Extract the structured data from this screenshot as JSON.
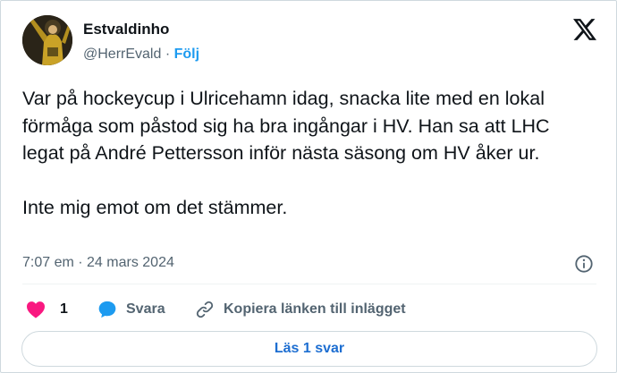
{
  "author": {
    "display_name": "Estvaldinho",
    "handle": "@HerrEvald",
    "separator": "·",
    "follow_label": "Följ"
  },
  "tweet": {
    "paragraph1": "Var på hockeycup i Ulricehamn idag, snacka lite med en lokal förmåga som påstod sig ha bra ingångar i HV. Han sa att LHC legat på André Pettersson inför nästa säsong om HV åker ur.",
    "paragraph2": "Inte mig emot om det stämmer.",
    "timestamp": "7:07 em · 24 mars 2024"
  },
  "actions": {
    "like_count": "1",
    "reply_label": "Svara",
    "copy_label": "Kopiera länken till inlägget"
  },
  "read_replies_label": "Läs 1 svar",
  "icons": [
    "avatar-photo",
    "x-logo-icon",
    "info-icon",
    "heart-icon",
    "reply-bubble-icon",
    "link-icon"
  ],
  "colors": {
    "accent": "#1d9bf0",
    "like": "#f91880",
    "secondary_text": "#536471",
    "primary_text": "#0f1419",
    "border": "#cfd9de"
  }
}
